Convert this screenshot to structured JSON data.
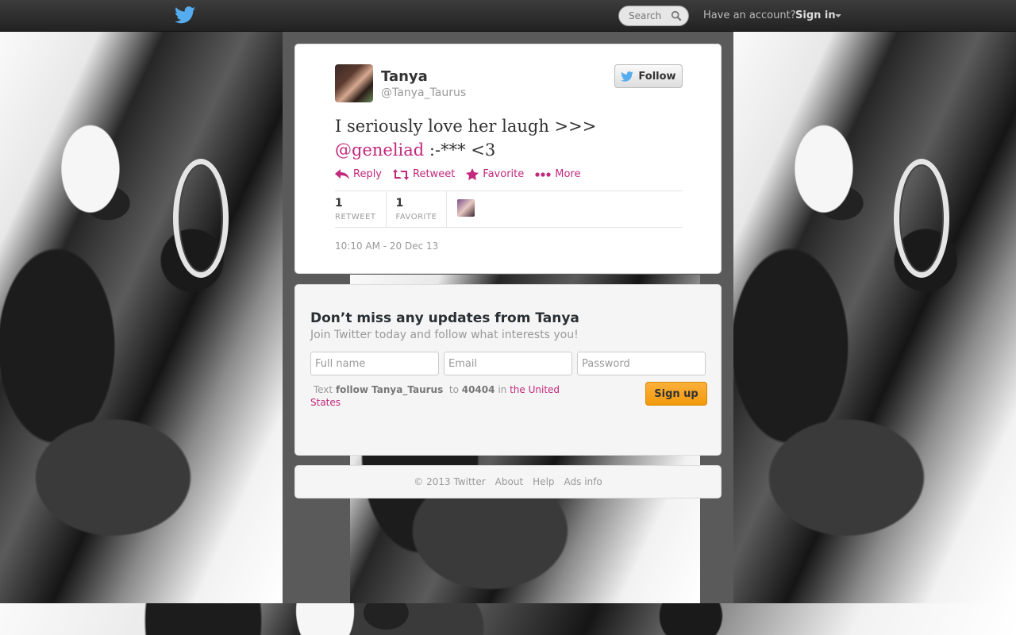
{
  "topbar": {
    "logo_icon": "twitter-bird-icon",
    "search_placeholder": "Search",
    "account_prompt": "Have an account?",
    "signin_label": "Sign in"
  },
  "tweet": {
    "user_name": "Tanya",
    "user_handle": "@Tanya_Taurus",
    "follow_label": "Follow",
    "text_before": "I seriously love her laugh >>> ",
    "mention": "@geneliad",
    "text_after": "  :-*** <3",
    "actions": [
      {
        "label": "Reply",
        "icon": "reply-icon"
      },
      {
        "label": "Retweet",
        "icon": "retweet-icon"
      },
      {
        "label": "Favorite",
        "icon": "star-icon"
      },
      {
        "label": "More",
        "icon": "more-dots-icon"
      }
    ],
    "stats": [
      {
        "count": "1",
        "label": "RETWEET"
      },
      {
        "count": "1",
        "label": "FAVORITE"
      }
    ],
    "timestamp": "10:10 AM - 20 Dec 13"
  },
  "signup": {
    "title": "Don’t miss any updates from Tanya",
    "subtitle": "Join Twitter today and follow what interests you!",
    "fullname_placeholder": "Full name",
    "email_placeholder": "Email",
    "password_placeholder": "Password",
    "sms_text": "Text",
    "sms_command": "follow Tanya_Taurus",
    "sms_to": "to",
    "sms_number": "40404",
    "sms_in": "in",
    "sms_country": "the United States",
    "button_label": "Sign up"
  },
  "footer": {
    "copyright": "© 2013 Twitter",
    "links": [
      "About",
      "Help",
      "Ads info"
    ]
  },
  "colors": {
    "accent": "#c2287c",
    "signup_button": "#f29a0c",
    "twitter_blue": "#55acee"
  }
}
